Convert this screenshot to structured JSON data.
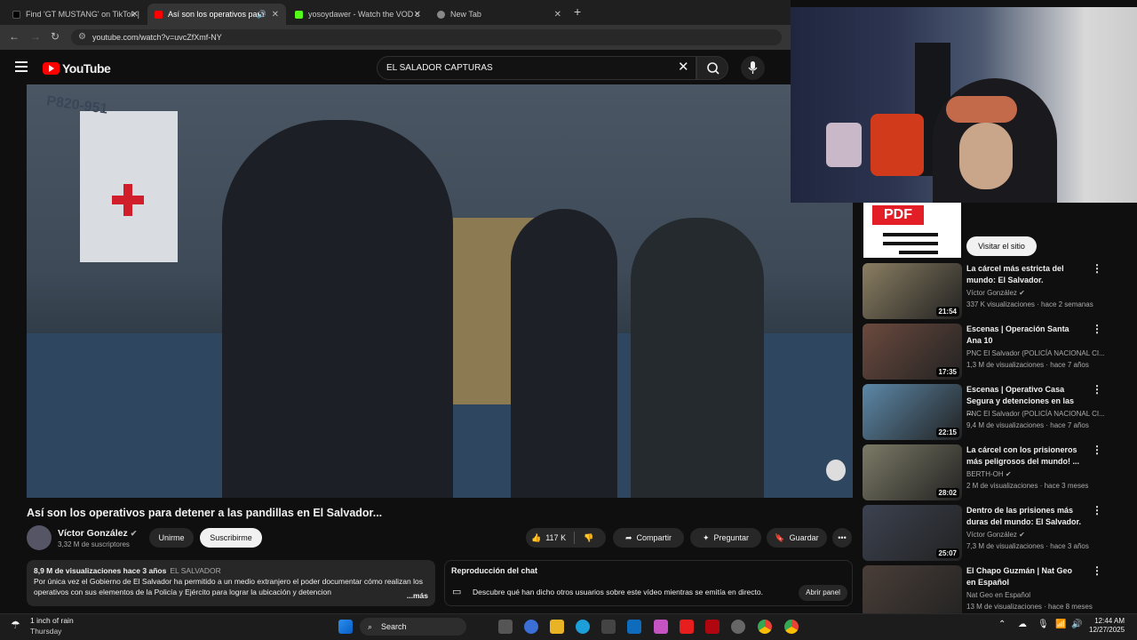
{
  "browser": {
    "tabs": [
      {
        "label": "Find 'GT MUSTANG' on TikTok |",
        "color": "#000000"
      },
      {
        "label": "Así son los operativos para",
        "color": "#ff0000"
      },
      {
        "label": "yosoydawer - Watch the VOD c",
        "color": "#53fc18"
      },
      {
        "label": "New Tab",
        "color": "#888888"
      }
    ],
    "url": "youtube.com/watch?v=uvcZfXmf-NY"
  },
  "youtube": {
    "logo": "YouTube",
    "search_value": "EL SALADOR CAPTURAS"
  },
  "video": {
    "title": "Así son los operativos para detener a las pandillas en El Salvador...",
    "channel": "Víctor González",
    "subscribers": "3,32 M de suscriptores",
    "join_label": "Unirme",
    "subscribe_label": "Suscribirme",
    "likes": "117 K",
    "share_label": "Compartir",
    "ask_label": "Preguntar",
    "save_label": "Guardar",
    "overlay_text": "P820-951"
  },
  "description": {
    "views": "8,9 M de visualizaciones",
    "age": "hace 3 años",
    "tag": "EL SALVADOR",
    "text": "Por única vez el Gobierno de El Salvador ha permitido a un medio extranjero el poder documentar cómo realizan los operativos con sus elementos de la Policía y Ejército para lograr la ubicación y detencion",
    "more": "...más"
  },
  "chat": {
    "title": "Reproducción del chat",
    "text": "Descubre qué han dicho otros usuarios sobre este vídeo mientras se emitía en directo.",
    "button": "Abrir panel"
  },
  "ad": {
    "logo_text": "PDF",
    "button": "Visitar el sitio"
  },
  "recommendations": [
    {
      "title": "La cárcel más estricta del mundo: El Salvador.",
      "channel": "Víctor González",
      "verified": true,
      "meta": "337 K visualizaciones · hace 2 semanas",
      "duration": "21:54",
      "color": "#8a7e62"
    },
    {
      "title": "Escenas | Operación Santa Ana 10",
      "channel": "PNC El Salvador (POLICÍA NACIONAL CI...",
      "verified": false,
      "meta": "1,3 M de visualizaciones · hace 7 años",
      "duration": "17:35",
      "color": "#6b4a3e"
    },
    {
      "title": "Escenas | Operativo Casa Segura  y detenciones en las ...",
      "channel": "PNC El Salvador (POLICÍA NACIONAL CI...",
      "verified": false,
      "meta": "9,4 M de visualizaciones · hace 7 años",
      "duration": "22:15",
      "color": "#5c88a8"
    },
    {
      "title": "La cárcel con los prisioneros más peligrosos del mundo! ...",
      "channel": "BERTH-OH",
      "verified": true,
      "meta": "2 M de visualizaciones · hace 3 meses",
      "duration": "28:02",
      "color": "#7c7a66"
    },
    {
      "title": "Dentro de las prisiones más duras del mundo: El Salvador.",
      "channel": "Víctor González",
      "verified": true,
      "meta": "7,3 M de visualizaciones · hace 3 años",
      "duration": "25:07",
      "color": "#3c4250"
    },
    {
      "title": "El Chapo Guzmán | Nat Geo en Español",
      "channel": "Nat Geo en Español",
      "verified": false,
      "meta": "13 M de visualizaciones · hace 8 meses",
      "duration": "",
      "color": "#4a3e38"
    }
  ],
  "taskbar": {
    "weather_line1": "1 inch of rain",
    "weather_line2": "Thursday",
    "search_label": "Search",
    "time": "12:44 AM",
    "date": "12/27/2025"
  }
}
